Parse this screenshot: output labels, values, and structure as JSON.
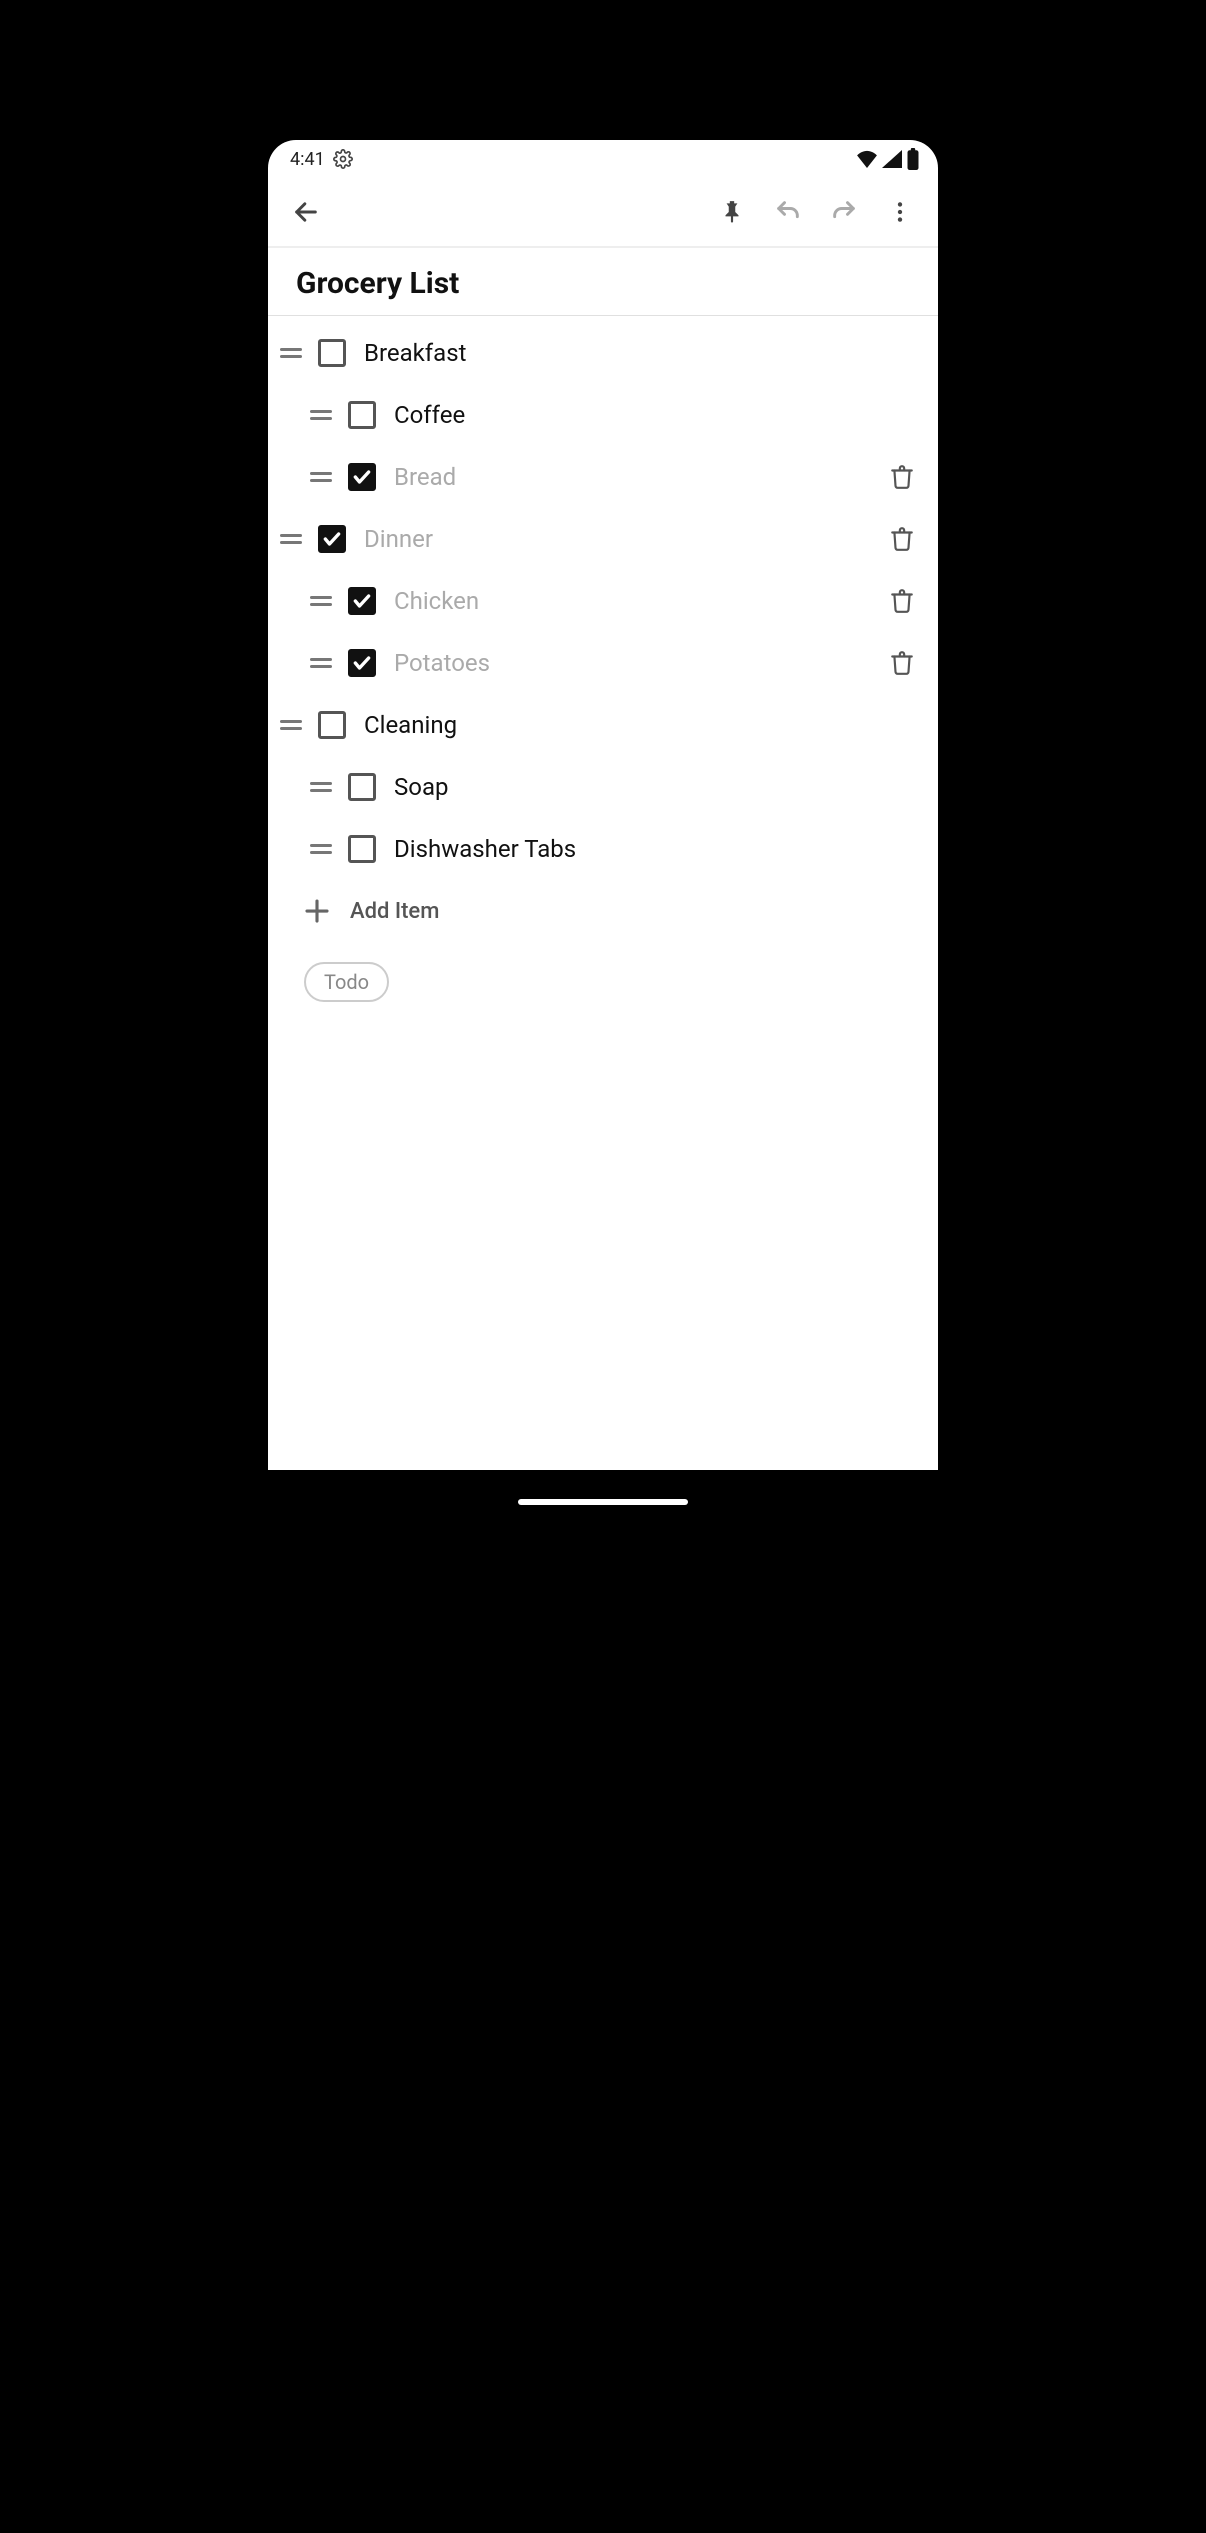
{
  "status": {
    "time": "4:41"
  },
  "title": "Grocery List",
  "add_label": "Add Item",
  "tag": "Todo",
  "items": [
    {
      "label": "Breakfast",
      "checked": false,
      "indent": 0,
      "trash": false
    },
    {
      "label": "Coffee",
      "checked": false,
      "indent": 1,
      "trash": false
    },
    {
      "label": "Bread",
      "checked": true,
      "indent": 1,
      "trash": true
    },
    {
      "label": "Dinner",
      "checked": true,
      "indent": 0,
      "trash": true
    },
    {
      "label": "Chicken",
      "checked": true,
      "indent": 1,
      "trash": true
    },
    {
      "label": "Potatoes",
      "checked": true,
      "indent": 1,
      "trash": true
    },
    {
      "label": "Cleaning",
      "checked": false,
      "indent": 0,
      "trash": false
    },
    {
      "label": "Soap",
      "checked": false,
      "indent": 1,
      "trash": false
    },
    {
      "label": "Dishwasher Tabs",
      "checked": false,
      "indent": 1,
      "trash": false
    }
  ]
}
